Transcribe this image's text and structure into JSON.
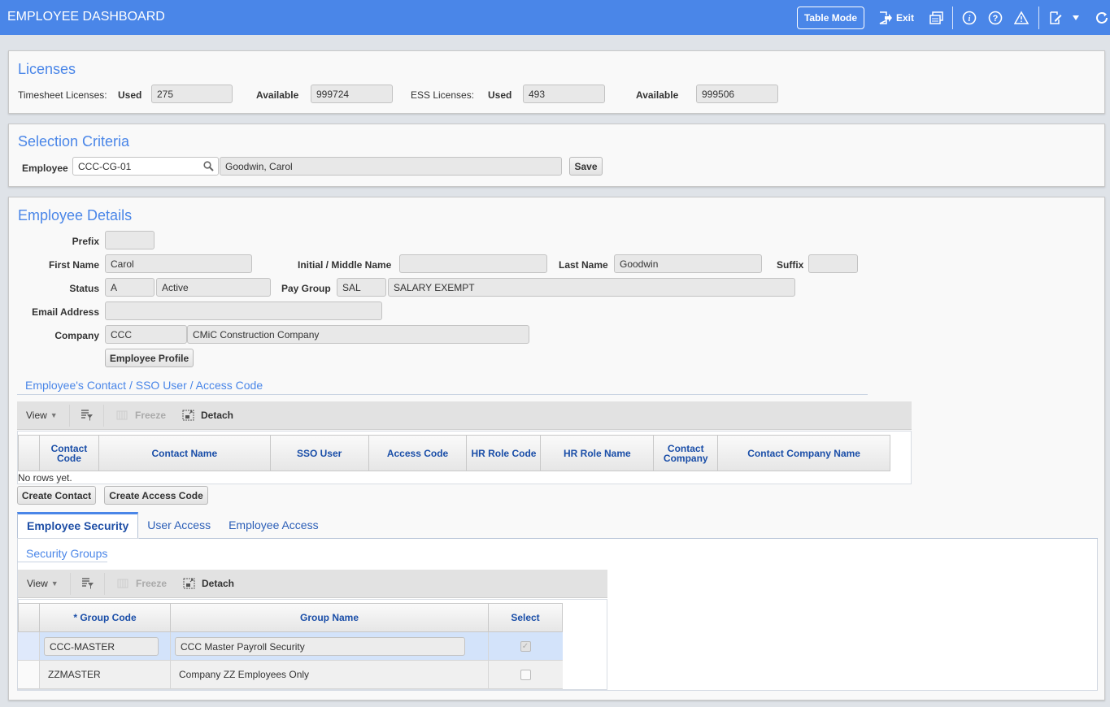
{
  "header": {
    "title": "EMPLOYEE DASHBOARD",
    "table_mode_label": "Table Mode",
    "exit_label": "Exit"
  },
  "licenses": {
    "title": "Licenses",
    "timesheet_label": "Timesheet Licenses:",
    "ess_label": "ESS Licenses:",
    "used_label": "Used",
    "available_label": "Available",
    "timesheet_used": "275",
    "timesheet_available": "999724",
    "ess_used": "493",
    "ess_available": "999506"
  },
  "selection": {
    "title": "Selection Criteria",
    "employee_label": "Employee",
    "employee_code": "CCC-CG-01",
    "employee_name": "Goodwin, Carol",
    "save_label": "Save"
  },
  "details": {
    "title": "Employee Details",
    "prefix_label": "Prefix",
    "prefix": "",
    "first_name_label": "First Name",
    "first_name": "Carol",
    "middle_label": "Initial / Middle Name",
    "middle": "",
    "last_name_label": "Last Name",
    "last_name": "Goodwin",
    "suffix_label": "Suffix",
    "suffix": "",
    "status_label": "Status",
    "status_code": "A",
    "status_name": "Active",
    "pay_group_label": "Pay Group",
    "pay_group_code": "SAL",
    "pay_group_name": "SALARY EXEMPT",
    "email_label": "Email Address",
    "email": "",
    "company_label": "Company",
    "company_code": "CCC",
    "company_name": "CMiC Construction Company",
    "profile_button": "Employee Profile"
  },
  "contacts": {
    "section_title": "Employee's Contact / SSO User / Access Code",
    "toolbar": {
      "view": "View",
      "freeze": "Freeze",
      "detach": "Detach"
    },
    "columns": [
      "Contact Code",
      "Contact Name",
      "SSO User",
      "Access Code",
      "HR Role Code",
      "HR Role Name",
      "Contact Company",
      "Contact Company Name"
    ],
    "empty_text": "No rows yet.",
    "create_contact": "Create Contact",
    "create_access_code": "Create Access Code"
  },
  "tabs": [
    {
      "label": "Employee Security",
      "active": true
    },
    {
      "label": "User Access",
      "active": false
    },
    {
      "label": "Employee Access",
      "active": false
    }
  ],
  "security": {
    "section_title": "Security Groups",
    "toolbar": {
      "view": "View",
      "freeze": "Freeze",
      "detach": "Detach"
    },
    "columns": [
      "* Group Code",
      "Group Name",
      "Select"
    ],
    "rows": [
      {
        "code": "CCC-MASTER",
        "name": "CCC Master Payroll Security",
        "selected": true
      },
      {
        "code": "ZZMASTER",
        "name": "Company ZZ Employees Only",
        "selected": false
      }
    ]
  }
}
